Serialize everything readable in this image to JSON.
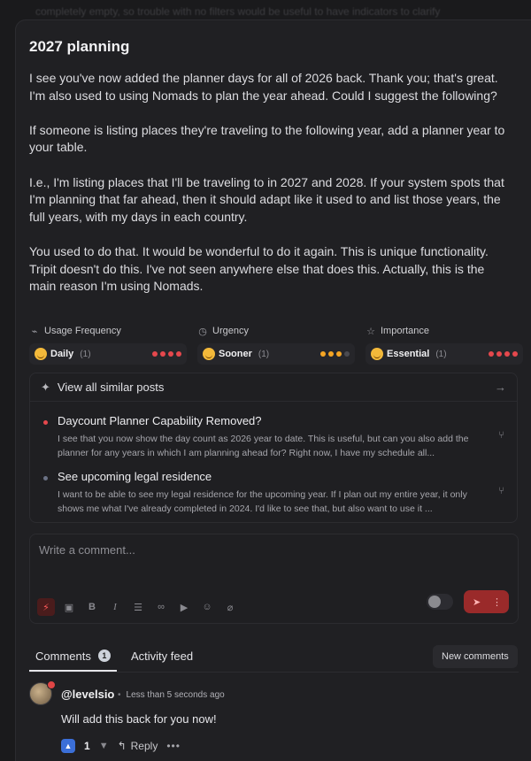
{
  "top_fade_text": "completely empty, so trouble with no filters would be useful to have indicators to clarify",
  "post": {
    "title": "2027 planning",
    "paragraphs": [
      "I see you've now added the planner days for all of 2026 back. Thank you; that's great. I'm also used to using Nomads to plan the year ahead. Could I suggest the following?",
      "If someone is listing places they're traveling to the following year, add a planner year to your table.",
      "I.e., I'm listing places that I'll be traveling to in 2027 and 2028. If your system spots that I'm planning that far ahead, then it should adapt like it used to and list those years, the full years, with my days in each country.",
      "You used to do that. It would be wonderful to do it again. This is unique functionality. Tripit doesn't do this. I've not seen anywhere else that does this. Actually, this is the main reason I'm using Nomads."
    ]
  },
  "meta": [
    {
      "label": "Usage Frequency",
      "icon": "activity-icon",
      "icon_glyph": "⌁",
      "value": "Daily",
      "count": "(1)",
      "dot_color": "#e5484d",
      "dots": 4
    },
    {
      "label": "Urgency",
      "icon": "clock-icon",
      "icon_glyph": "◷",
      "value": "Sooner",
      "count": "(1)",
      "dot_color": "#f5a524",
      "dots": 3
    },
    {
      "label": "Importance",
      "icon": "star-icon",
      "icon_glyph": "☆",
      "value": "Essential",
      "count": "(1)",
      "dot_color": "#e5484d",
      "dots": 4
    }
  ],
  "similar": {
    "header": "View all similar posts",
    "items": [
      {
        "title": "Daycount Planner Capability Removed?",
        "desc": "I see that you now show the day count as 2026 year to date. This is useful, but can you also add the planner for any years in which I am planning ahead for? Right now, I have my schedule all...",
        "bullet_color": "#e5484d"
      },
      {
        "title": "See upcoming legal residence",
        "desc": "I want to be able to see my legal residence for the upcoming year. If I plan out my entire year, it only shows me what I've already completed in 2024. I'd like to see that, but also want to use it ...",
        "bullet_color": "#6b7285"
      }
    ]
  },
  "composer": {
    "placeholder": "Write a comment..."
  },
  "tabs": {
    "comments": "Comments",
    "comments_count": "1",
    "activity": "Activity feed",
    "new_comments": "New comments"
  },
  "comment": {
    "user": "@levelsio",
    "time": "Less than 5 seconds ago",
    "text": "Will add this back for you now!",
    "like_count": "1",
    "reply_label": "Reply"
  }
}
